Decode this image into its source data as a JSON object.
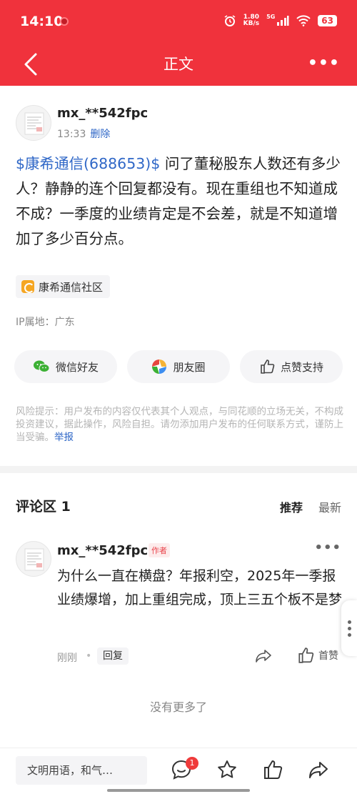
{
  "status": {
    "time": "14:10",
    "net_speed": "1.80",
    "net_unit": "KB/s",
    "signal_label": "5G",
    "battery": "63"
  },
  "nav": {
    "title": "正文"
  },
  "post": {
    "username": "mx_**542fpc",
    "time": "13:33",
    "delete_label": "删除",
    "stock_tag": "$康希通信(688653)$",
    "text": " 问了董秘股东人数还有多少人？静静的连个回复都没有。现在重组也不知道成不成？一季度的业绩肯定是不会差，就是不知道增加了多少百分点。",
    "community": "康希通信社区",
    "ip": "IP属地：广东"
  },
  "share": {
    "wechat": "微信好友",
    "moments": "朋友圈",
    "like": "点赞支持"
  },
  "risk": {
    "text": "风险提示：用户发布的内容仅代表其个人观点，与同花顺的立场无关，不构成投资建议，据此操作，风险自担。请勿添加用户发布的任何联系方式，谨防上当受骗。",
    "report": "举报"
  },
  "comments": {
    "title": "评论区 1",
    "sort_recommended": "推荐",
    "sort_latest": "最新",
    "items": [
      {
        "username": "mx_**542fpc",
        "author_tag": "作者",
        "text": "为什么一直在横盘？年报利空，2025年一季报业绩爆增，加上重组完成，顶上三五个板不是梦",
        "time": "刚刚",
        "dot": "•",
        "reply": "回复",
        "like": "首赞"
      }
    ],
    "no_more": "没有更多了"
  },
  "bottom": {
    "placeholder": "文明用语，和气…",
    "badge": "1"
  },
  "colors": {
    "brand_red": "#f0323c",
    "link_blue": "#2f67c7"
  }
}
